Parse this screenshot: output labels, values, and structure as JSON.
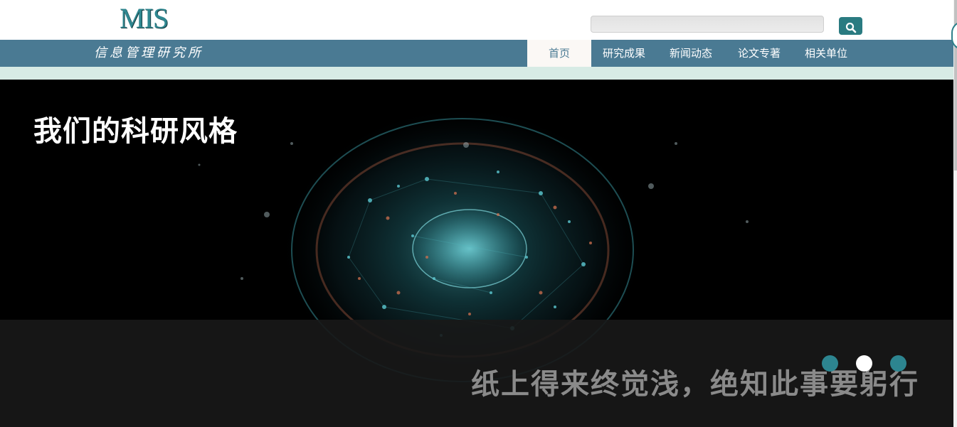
{
  "header": {
    "logo_text": "MIS",
    "search": {
      "value": "",
      "placeholder": ""
    },
    "search_button_icon": "search-icon"
  },
  "nav": {
    "subtitle": "信息管理研究所",
    "items": [
      {
        "label": "首页",
        "active": true
      },
      {
        "label": "研究成果",
        "active": false
      },
      {
        "label": "新闻动态",
        "active": false
      },
      {
        "label": "论文专著",
        "active": false
      },
      {
        "label": "相关单位",
        "active": false
      }
    ]
  },
  "banner": {
    "title": "我们的科研风格",
    "caption": "纸上得来终觉浅，绝知此事要躬行",
    "slides_total": 3,
    "active_slide": 2
  },
  "colors": {
    "nav_bg": "#4a7a93",
    "accent": "#2a7b81",
    "strip": "#d7ebe5",
    "banner_bg": "#000000"
  }
}
